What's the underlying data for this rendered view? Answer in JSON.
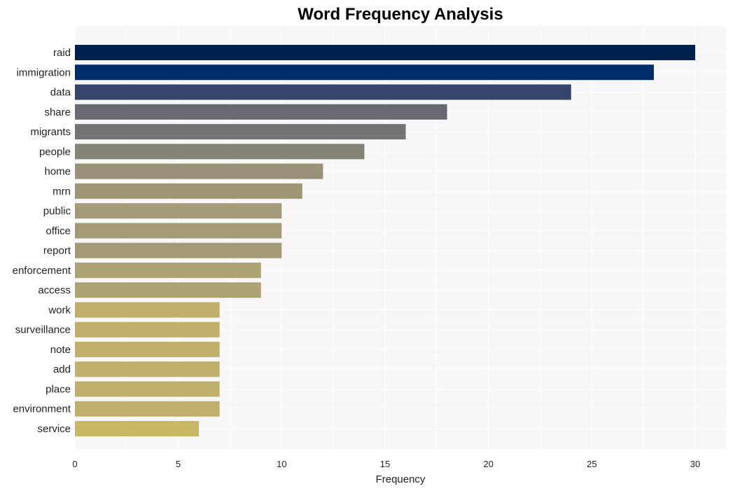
{
  "chart_data": {
    "type": "bar",
    "orientation": "horizontal",
    "title": "Word Frequency Analysis",
    "xlabel": "Frequency",
    "ylabel": "",
    "xlim": [
      0,
      31.5
    ],
    "xticks": [
      0,
      5,
      10,
      15,
      20,
      25,
      30
    ],
    "grid": true,
    "categories": [
      "raid",
      "immigration",
      "data",
      "share",
      "migrants",
      "people",
      "home",
      "mrn",
      "public",
      "office",
      "report",
      "enforcement",
      "access",
      "work",
      "surveillance",
      "note",
      "add",
      "place",
      "environment",
      "service"
    ],
    "values": [
      30,
      28,
      24,
      18,
      16,
      14,
      12,
      11,
      10,
      10,
      10,
      9,
      9,
      7,
      7,
      7,
      7,
      7,
      7,
      6
    ],
    "colors": [
      "#00204e",
      "#002c6a",
      "#35456b",
      "#686a70",
      "#747474",
      "#868479",
      "#999178",
      "#9f9676",
      "#a49b76",
      "#a49b76",
      "#a49b76",
      "#ada271",
      "#ada271",
      "#c1b06c",
      "#c1b06c",
      "#c1b06c",
      "#c1b06c",
      "#c1b06c",
      "#c1b06c",
      "#c9b866"
    ]
  }
}
